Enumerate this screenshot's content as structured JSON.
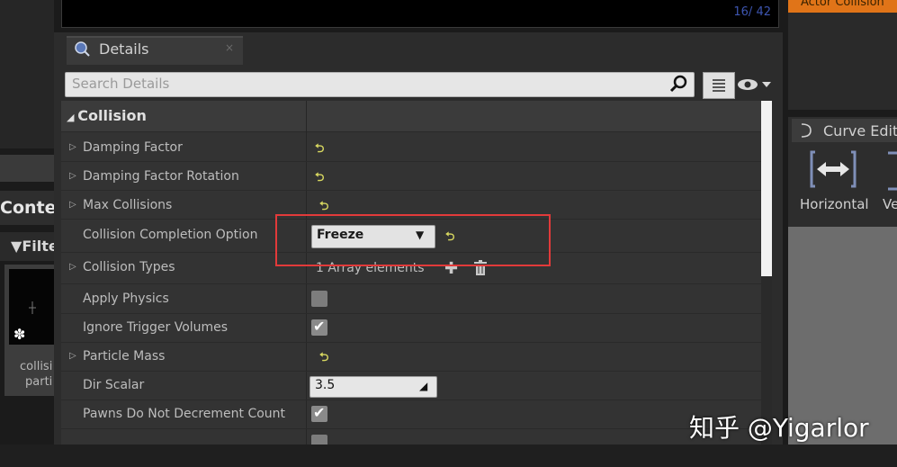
{
  "left_panel": {
    "content_tab": "Conten",
    "filter": "Filte",
    "asset_label_line1": "collisi",
    "asset_label_line2": "parti"
  },
  "viewport": {
    "frame_counter": "16/ 42"
  },
  "details": {
    "tab_title": "Details",
    "tab_close": "×",
    "search_placeholder": "Search Details",
    "category": "Collision",
    "properties": [
      {
        "label": "Damping Factor",
        "expandable": true
      },
      {
        "label": "Damping Factor Rotation",
        "expandable": true
      },
      {
        "label": "Max Collisions",
        "expandable": true
      },
      {
        "label": "Collision Completion Option",
        "expandable": false,
        "value": "Freeze"
      },
      {
        "label": "Collision Types",
        "expandable": true,
        "value": "1 Array elements"
      },
      {
        "label": "Apply Physics",
        "expandable": false,
        "checked": false
      },
      {
        "label": "Ignore Trigger Volumes",
        "expandable": false,
        "checked": true
      },
      {
        "label": "Particle Mass",
        "expandable": true
      },
      {
        "label": "Dir Scalar",
        "expandable": false,
        "value": "3.5"
      },
      {
        "label": "Pawns Do Not Decrement Count",
        "expandable": false,
        "checked": true
      }
    ]
  },
  "right_panel": {
    "top_tab_text": "Actor Collision",
    "curve_editor_tab": "Curve Edito",
    "horizontal_label": "Horizontal",
    "vertical_label": "Ve"
  },
  "watermark": "知乎 @Yigarlor",
  "colors": {
    "highlight": "#e23a3a",
    "reset_arrow": "#d8d860",
    "accent_orange": "#e07418"
  }
}
